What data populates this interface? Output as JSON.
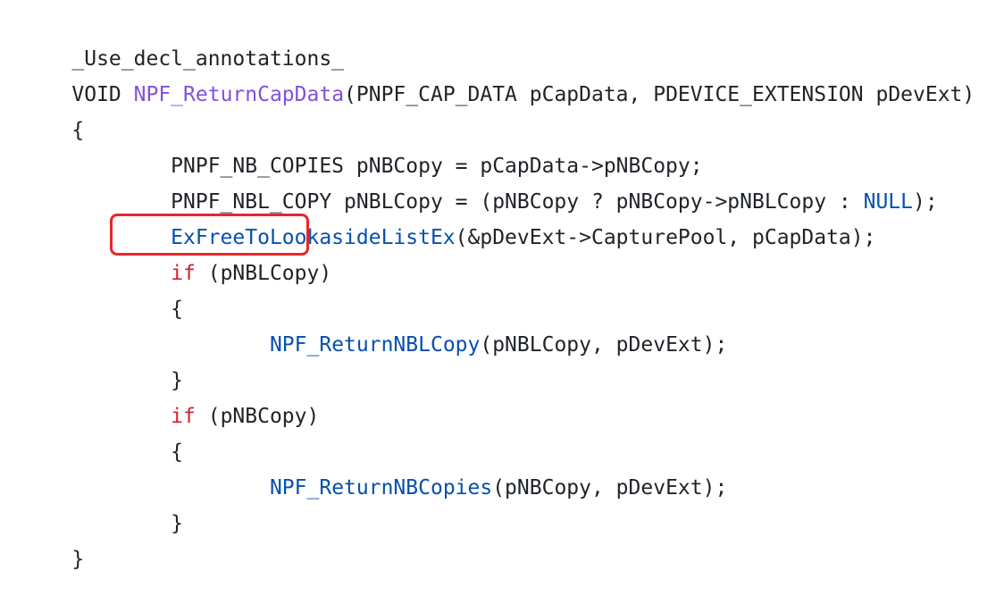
{
  "code": {
    "lines": [
      {
        "tokens": [
          {
            "text": "_Use_decl_annotations_",
            "kind": "plain"
          }
        ]
      },
      {
        "tokens": [
          {
            "text": "VOID ",
            "kind": "plain"
          },
          {
            "text": "NPF_ReturnCapData",
            "kind": "func-def"
          },
          {
            "text": "(PNPF_CAP_DATA pCapData, PDEVICE_EXTENSION pDevExt)",
            "kind": "plain"
          }
        ]
      },
      {
        "tokens": [
          {
            "text": "{",
            "kind": "plain"
          }
        ]
      },
      {
        "tokens": [
          {
            "text": "        PNPF_NB_COPIES pNBCopy = pCapData->pNBCopy;",
            "kind": "plain"
          }
        ]
      },
      {
        "tokens": [
          {
            "text": "        PNPF_NBL_COPY pNBLCopy = (pNBCopy ? pNBCopy->pNBLCopy : ",
            "kind": "plain"
          },
          {
            "text": "NULL",
            "kind": "constant"
          },
          {
            "text": ");",
            "kind": "plain"
          }
        ]
      },
      {
        "tokens": [
          {
            "text": "        ",
            "kind": "plain"
          },
          {
            "text": "ExFreeToLookasideListEx",
            "kind": "func-call"
          },
          {
            "text": "(&pDevExt->CapturePool, pCapData);",
            "kind": "plain"
          }
        ]
      },
      {
        "tokens": [
          {
            "text": "        ",
            "kind": "plain"
          },
          {
            "text": "if",
            "kind": "keyword"
          },
          {
            "text": " (pNBLCopy)",
            "kind": "plain"
          }
        ]
      },
      {
        "tokens": [
          {
            "text": "        {",
            "kind": "plain"
          }
        ]
      },
      {
        "tokens": [
          {
            "text": "                ",
            "kind": "plain"
          },
          {
            "text": "NPF_ReturnNBLCopy",
            "kind": "func-call"
          },
          {
            "text": "(pNBLCopy, pDevExt);",
            "kind": "plain"
          }
        ]
      },
      {
        "tokens": [
          {
            "text": "        }",
            "kind": "plain"
          }
        ]
      },
      {
        "tokens": [
          {
            "text": "        ",
            "kind": "plain"
          },
          {
            "text": "if",
            "kind": "keyword"
          },
          {
            "text": " (pNBCopy)",
            "kind": "plain"
          }
        ]
      },
      {
        "tokens": [
          {
            "text": "        {",
            "kind": "plain"
          }
        ]
      },
      {
        "tokens": [
          {
            "text": "                ",
            "kind": "plain"
          },
          {
            "text": "NPF_ReturnNBCopies",
            "kind": "func-call"
          },
          {
            "text": "(pNBCopy, pDevExt);",
            "kind": "plain"
          }
        ]
      },
      {
        "tokens": [
          {
            "text": "        }",
            "kind": "plain"
          }
        ]
      },
      {
        "tokens": [
          {
            "text": "}",
            "kind": "plain"
          }
        ]
      }
    ],
    "highlighted_line": 6
  },
  "colors": {
    "background": "#ffffff",
    "plain_text": "#1f2328",
    "keyword": "#cf222e",
    "function_definition": "#8250df",
    "function_call": "#0550ae",
    "constant": "#0550ae",
    "highlight_border": "#e8262b"
  }
}
